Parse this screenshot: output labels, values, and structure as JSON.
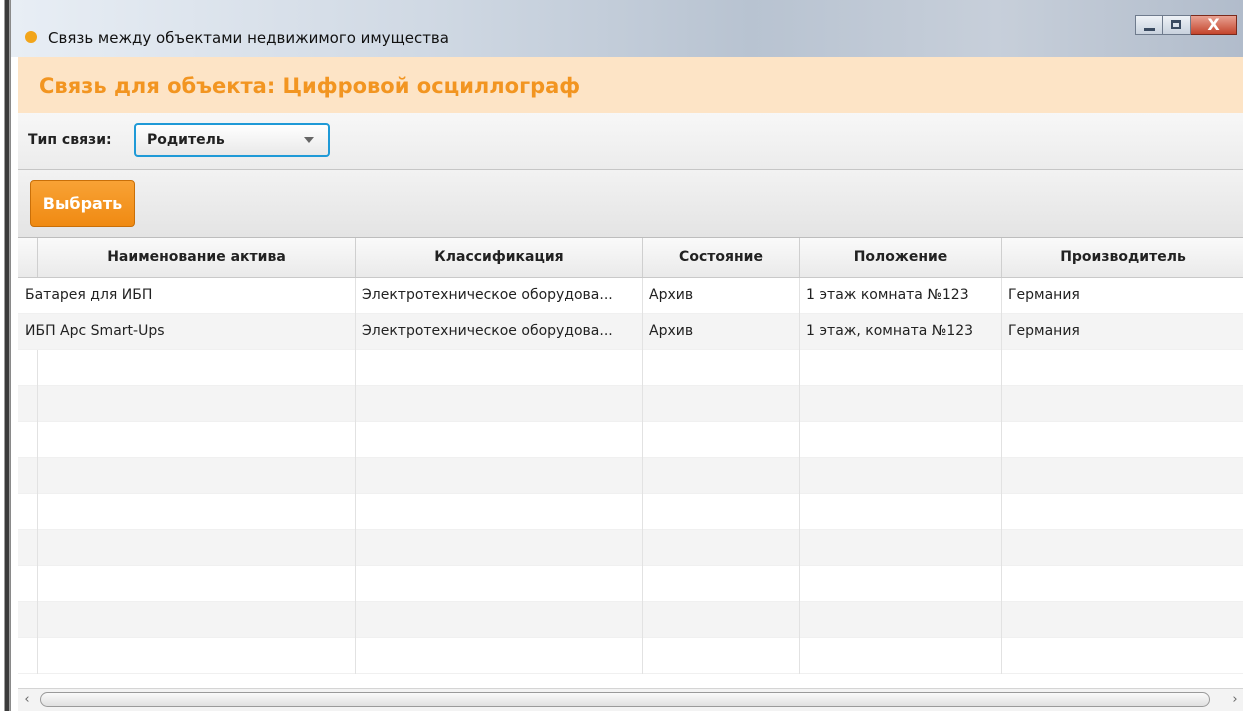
{
  "window": {
    "title": "Связь между объектами недвижимого имущества"
  },
  "header": {
    "title": "Связь для объекта: Цифровой осциллограф"
  },
  "filter": {
    "label": "Тип связи:",
    "selected": "Родитель"
  },
  "toolbar": {
    "select_label": "Выбрать"
  },
  "table": {
    "columns": [
      "Наименование актива",
      "Классификация",
      "Состояние",
      "Положение",
      "Производитель"
    ],
    "rows": [
      [
        "Батарея для ИБП",
        "Электротехническое оборудова...",
        "Архив",
        "1 этаж комната №123",
        "Германия"
      ],
      [
        "ИБП Apc Smart-Ups",
        "Электротехническое оборудова...",
        "Архив",
        "1 этаж, комната №123",
        "Германия"
      ]
    ]
  },
  "colors": {
    "accent": "#f29521",
    "header_bg": "#fde4c6",
    "combo_border": "#1f9ad7"
  },
  "icons": {
    "app": "app-dot-icon",
    "minimize": "minimize-icon",
    "maximize": "maximize-icon",
    "close": "close-icon",
    "dropdown": "chevron-down-icon",
    "scroll_left": "scroll-left-icon",
    "scroll_right": "scroll-right-icon"
  }
}
